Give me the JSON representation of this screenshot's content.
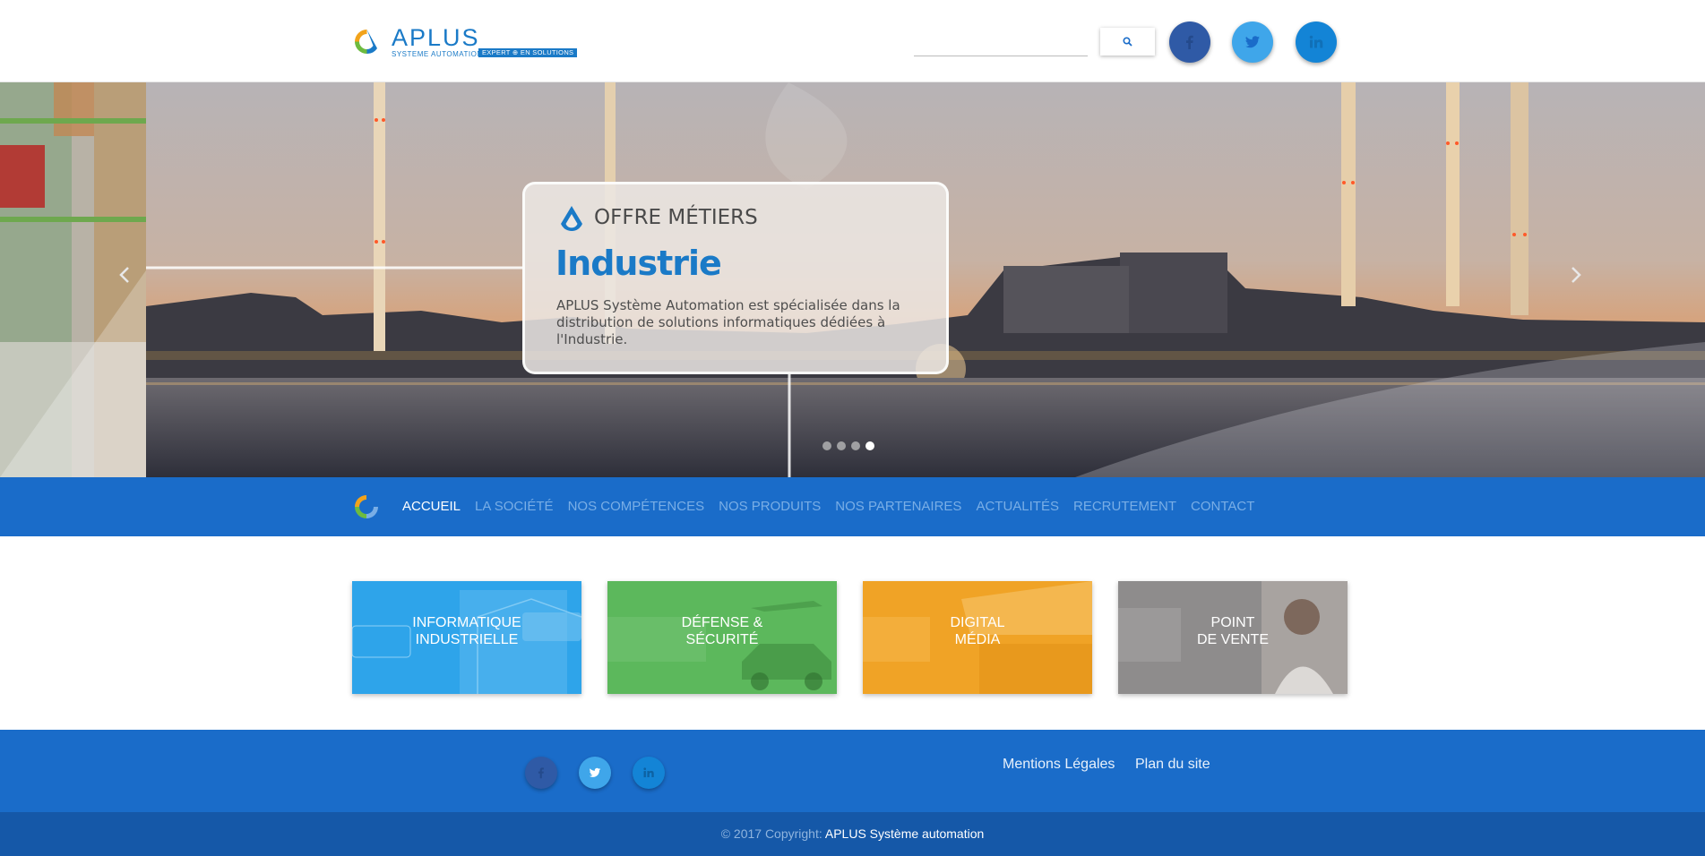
{
  "header": {
    "logo": {
      "name": "APLUS",
      "subtitle": "SYSTEME AUTOMATION",
      "tagline": "EXPERT ⊕ EN SOLUTIONS"
    },
    "search": {
      "placeholder": "",
      "value": ""
    },
    "social": [
      {
        "name": "facebook",
        "icon": "facebook-icon",
        "color": "#2f5aa6"
      },
      {
        "name": "twitter",
        "icon": "twitter-icon",
        "color": "#3fa6ea"
      },
      {
        "name": "linkedin",
        "icon": "linkedin-icon",
        "color": "#1384d6"
      }
    ]
  },
  "slider": {
    "card": {
      "kicker": "OFFRE MÉTIERS",
      "heading": "Industrie",
      "text": "APLUS Système Automation est spécialisée dans la distribution de solutions informatiques dédiées à l'Industrie."
    },
    "slides_count": 4,
    "active_slide": 4
  },
  "nav": {
    "items": [
      {
        "label": "ACCUEIL",
        "active": true
      },
      {
        "label": "LA SOCIÉTÉ",
        "active": false
      },
      {
        "label": "NOS COMPÉTENCES",
        "active": false
      },
      {
        "label": "NOS PRODUITS",
        "active": false
      },
      {
        "label": "NOS PARTENAIRES",
        "active": false
      },
      {
        "label": "ACTUALITÉS",
        "active": false
      },
      {
        "label": "RECRUTEMENT",
        "active": false
      },
      {
        "label": "CONTACT",
        "active": false
      }
    ]
  },
  "tiles": [
    {
      "line1": "INFORMATIQUE",
      "line2": "INDUSTRIELLE",
      "color": "#2fa3e8"
    },
    {
      "line1": "DÉFENSE &",
      "line2": "SÉCURITÉ",
      "color": "#5cb85c"
    },
    {
      "line1": "DIGITAL",
      "line2": "MÉDIA",
      "color": "#f0a326"
    },
    {
      "line1": "POINT",
      "line2": "DE VENTE",
      "color": "#8c8c8c"
    }
  ],
  "footer": {
    "links": [
      "Mentions Légales",
      "Plan du site"
    ],
    "copyright_prefix": "© 2017 Copyright:",
    "copyright_brand": "APLUS Système automation"
  }
}
